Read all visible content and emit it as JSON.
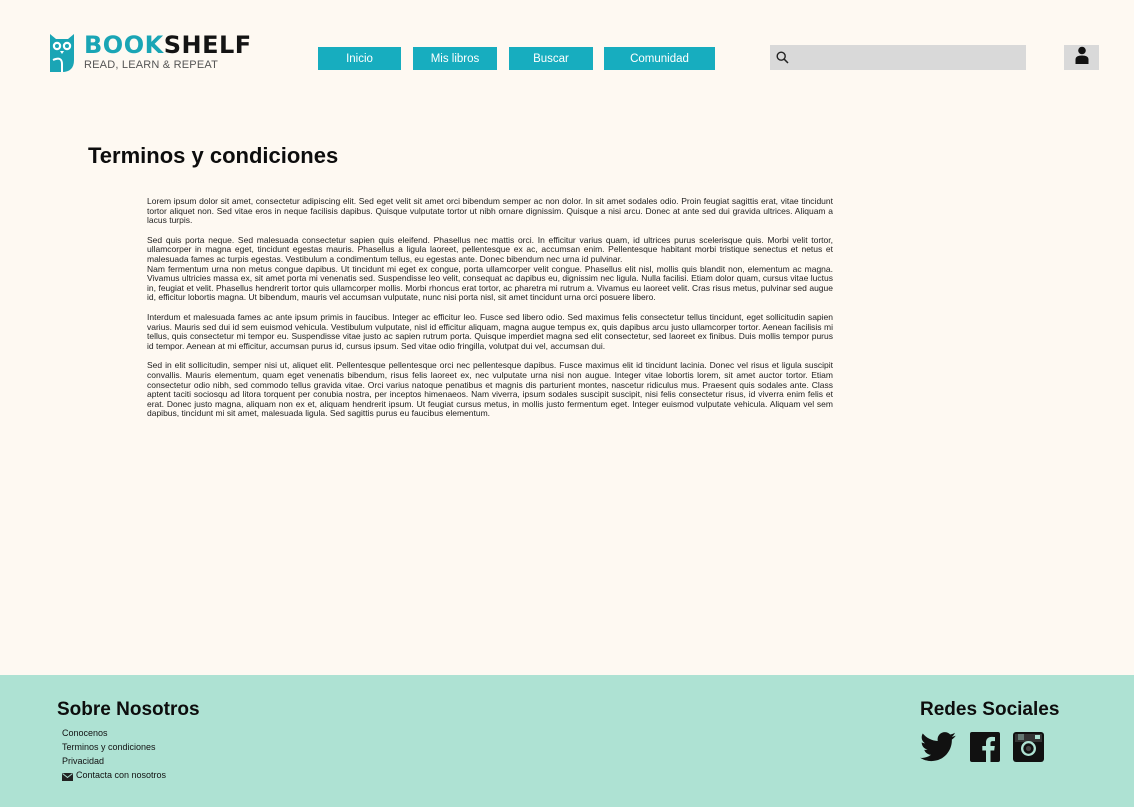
{
  "brand": {
    "name_part1": "BOOK",
    "name_part2": "SHELF",
    "tagline": "READ, LEARN & REPEAT"
  },
  "nav": {
    "items": [
      {
        "label": "Inicio"
      },
      {
        "label": "Mis libros"
      },
      {
        "label": "Buscar"
      },
      {
        "label": "Comunidad"
      }
    ]
  },
  "search": {
    "placeholder": "",
    "icon": "search-icon"
  },
  "user": {
    "icon": "user-icon"
  },
  "main": {
    "title": "Terminos y condiciones",
    "paragraphs": [
      "Lorem ipsum dolor sit amet, consectetur adipiscing elit. Sed eget velit sit amet orci bibendum semper ac non dolor. In sit amet sodales odio. Proin feugiat sagittis erat, vitae tincidunt tortor aliquet non. Sed vitae eros in neque facilisis dapibus. Quisque vulputate tortor ut nibh ornare dignissim. Quisque a nisi arcu. Donec at ante sed dui gravida ultrices. Aliquam a lacus turpis.",
      "Sed quis porta neque. Sed malesuada consectetur sapien quis eleifend. Phasellus nec mattis orci. In efficitur varius quam, id ultrices purus scelerisque quis. Morbi velit tortor, ullamcorper in magna eget, tincidunt egestas mauris. Phasellus a ligula laoreet, pellentesque ex ac, accumsan enim. Pellentesque habitant morbi tristique senectus et netus et malesuada fames ac turpis egestas. Vestibulum a condimentum tellus, eu egestas ante. Donec bibendum nec urna id pulvinar.",
      "Nam fermentum urna non metus congue dapibus. Ut tincidunt mi eget ex congue, porta ullamcorper velit congue. Phasellus elit nisl, mollis quis blandit non, elementum ac magna. Vivamus ultricies massa ex, sit amet porta mi venenatis sed. Suspendisse leo velit, consequat ac dapibus eu, dignissim nec ligula. Nulla facilisi. Etiam dolor quam, cursus vitae luctus in, feugiat et velit. Phasellus hendrerit tortor quis ullamcorper mollis. Morbi rhoncus erat tortor, ac pharetra mi rutrum a. Vivamus eu laoreet velit. Cras risus metus, pulvinar sed augue id, efficitur lobortis magna. Ut bibendum, mauris vel accumsan vulputate, nunc nisi porta nisl, sit amet tincidunt urna orci posuere libero.",
      "Interdum et malesuada fames ac ante ipsum primis in faucibus. Integer ac efficitur leo. Fusce sed libero odio. Sed maximus felis consectetur tellus tincidunt, eget sollicitudin sapien varius. Mauris sed dui id sem euismod vehicula. Vestibulum vulputate, nisl id efficitur aliquam, magna augue tempus ex, quis dapibus arcu justo ullamcorper tortor. Aenean facilisis mi tellus, quis consectetur mi tempor eu. Suspendisse vitae justo ac sapien rutrum porta. Quisque imperdiet magna sed elit consectetur, sed laoreet ex finibus. Duis mollis tempor purus id tempor. Aenean at mi efficitur, accumsan purus id, cursus ipsum. Sed vitae odio fringilla, volutpat dui vel, accumsan dui.",
      "Sed in elit sollicitudin, semper nisi ut, aliquet elit. Pellentesque pellentesque orci nec pellentesque dapibus. Fusce maximus elit id tincidunt lacinia. Donec vel risus et ligula suscipit convallis. Mauris elementum, quam eget venenatis bibendum, risus felis laoreet ex, nec vulputate urna nisi non augue. Integer vitae lobortis lorem, sit amet auctor tortor. Etiam consectetur odio nibh, sed commodo tellus gravida vitae. Orci varius natoque penatibus et magnis dis parturient montes, nascetur ridiculus mus. Praesent quis sodales ante. Class aptent taciti sociosqu ad litora torquent per conubia nostra, per inceptos himenaeos. Nam viverra, ipsum sodales suscipit suscipit, nisi felis consectetur risus, id viverra enim felis et erat. Donec justo magna, aliquam non ex et, aliquam hendrerit ipsum. Ut feugiat cursus metus, in mollis justo fermentum eget. Integer euismod vulputate vehicula. Aliquam vel sem dapibus, tincidunt mi sit amet, malesuada ligula. Sed sagittis purus eu faucibus elementum."
    ]
  },
  "footer": {
    "about_heading": "Sobre Nosotros",
    "links": [
      {
        "label": "Conocenos"
      },
      {
        "label": "Terminos y condiciones"
      },
      {
        "label": "Privacidad"
      },
      {
        "label": "Contacta con nosotros",
        "icon": "mail-icon"
      }
    ],
    "social_heading": "Redes Sociales",
    "social": [
      {
        "icon": "twitter-icon"
      },
      {
        "icon": "facebook-icon"
      },
      {
        "icon": "instagram-icon"
      }
    ]
  },
  "colors": {
    "accent": "#17adbf",
    "background": "#fef9f2",
    "footer": "#aee2d3",
    "search_bg": "#d9d9d9"
  }
}
